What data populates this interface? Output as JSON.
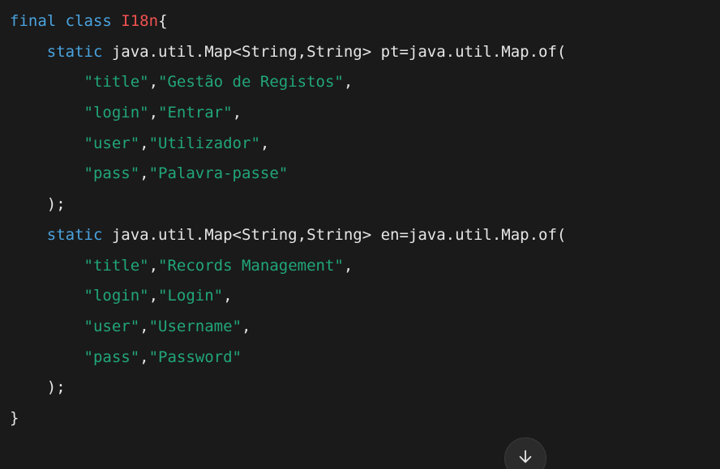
{
  "code": {
    "lines": [
      {
        "kw1": "final class",
        "space": " ",
        "class_name": "I18n",
        "rest": "{"
      },
      {
        "indent": "    ",
        "kw1": "static",
        "rest": " java.util.Map<String,String> pt=java.util.Map.of("
      },
      {
        "indent": "        ",
        "k": "\"title\"",
        "comma1": ",",
        "v": "\"Gestão de Registos\"",
        "comma2": ","
      },
      {
        "indent": "        ",
        "k": "\"login\"",
        "comma1": ",",
        "v": "\"Entrar\"",
        "comma2": ","
      },
      {
        "indent": "        ",
        "k": "\"user\"",
        "comma1": ",",
        "v": "\"Utilizador\"",
        "comma2": ","
      },
      {
        "indent": "        ",
        "k": "\"pass\"",
        "comma1": ",",
        "v": "\"Palavra-passe\"",
        "comma2": ""
      },
      {
        "indent": "    ",
        "rest": ");"
      },
      {
        "indent": "    ",
        "kw1": "static",
        "rest": " java.util.Map<String,String> en=java.util.Map.of("
      },
      {
        "indent": "        ",
        "k": "\"title\"",
        "comma1": ",",
        "v": "\"Records Management\"",
        "comma2": ","
      },
      {
        "indent": "        ",
        "k": "\"login\"",
        "comma1": ",",
        "v": "\"Login\"",
        "comma2": ","
      },
      {
        "indent": "        ",
        "k": "\"user\"",
        "comma1": ",",
        "v": "\"Username\"",
        "comma2": ","
      },
      {
        "indent": "        ",
        "k": "\"pass\"",
        "comma1": ",",
        "v": "\"Password\"",
        "comma2": ""
      },
      {
        "indent": "    ",
        "rest": ");"
      },
      {
        "rest": "}"
      }
    ]
  },
  "scroll_button": {
    "icon": "arrow-down-icon"
  },
  "colors": {
    "background": "#1a1a1a",
    "keyword": "#4aa3df",
    "class_name": "#f0524f",
    "string": "#21a67a",
    "text": "#e6e6e6"
  }
}
